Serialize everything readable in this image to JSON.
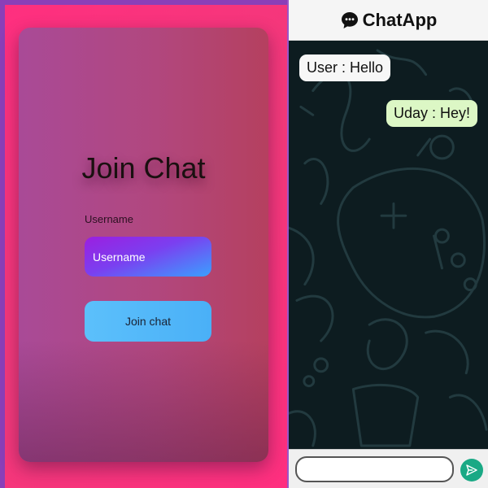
{
  "login": {
    "title": "Join Chat",
    "username_label": "Username",
    "username_placeholder": "Username",
    "join_button_label": "Join chat"
  },
  "chat": {
    "app_title": "ChatApp",
    "app_icon": "speech-bubble-icon",
    "messages": [
      {
        "text": "User : Hello",
        "direction": "incoming"
      },
      {
        "text": "Uday : Hey!",
        "direction": "outgoing"
      }
    ],
    "message_input_value": "",
    "send_icon": "send-icon"
  },
  "colors": {
    "accent_pink": "#ff2f7f",
    "send_green": "#1aa985",
    "outgoing_bubble": "#dcf7c5",
    "chat_background": "#0d1c20"
  }
}
